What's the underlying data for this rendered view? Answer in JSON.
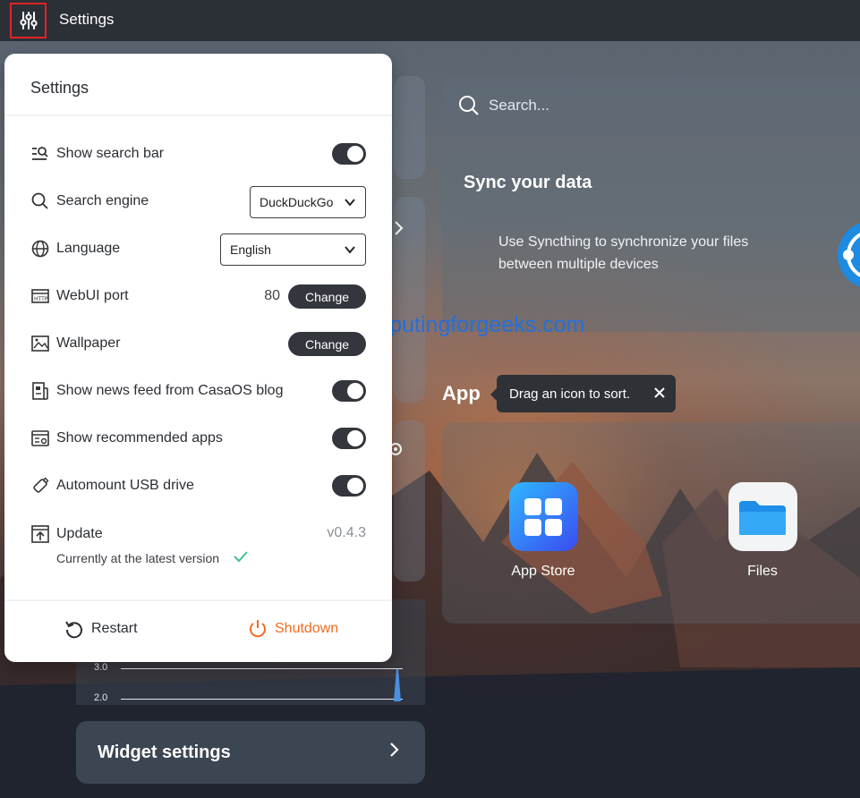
{
  "topbar": {
    "title": "Settings",
    "settings_icon": "sliders-icon"
  },
  "panel": {
    "title": "Settings",
    "rows": {
      "search_bar": {
        "label": "Show search bar",
        "enabled": true,
        "icon": "search-bar-icon"
      },
      "search_engine": {
        "label": "Search engine",
        "value": "DuckDuckGo",
        "icon": "search-icon"
      },
      "language": {
        "label": "Language",
        "value": "English",
        "icon": "globe-icon"
      },
      "webui_port": {
        "label": "WebUI port",
        "value": "80",
        "button": "Change",
        "icon": "http-icon"
      },
      "wallpaper": {
        "label": "Wallpaper",
        "button": "Change",
        "icon": "image-icon"
      },
      "news_feed": {
        "label": "Show news feed from CasaOS blog",
        "enabled": true,
        "icon": "news-icon"
      },
      "recommended_apps": {
        "label": "Show recommended apps",
        "enabled": true,
        "icon": "apps-window-icon"
      },
      "automount": {
        "label": "Automount USB drive",
        "enabled": true,
        "icon": "usb-icon"
      },
      "update": {
        "label": "Update",
        "version": "v0.4.3",
        "status": "Currently at the latest version",
        "icon": "update-icon"
      }
    },
    "footer": {
      "restart": "Restart",
      "shutdown": "Shutdown"
    }
  },
  "search": {
    "placeholder": "Search..."
  },
  "sync_card": {
    "title": "Sync your data",
    "description": "Use Syncthing to synchronize your files between multiple devices"
  },
  "watermark": "computingforgeeks.com",
  "apps": {
    "title": "App",
    "tooltip": "Drag an icon to sort.",
    "items": [
      {
        "name": "App Store",
        "icon": "app-store-icon"
      },
      {
        "name": "Files",
        "icon": "folder-icon"
      }
    ]
  },
  "chart_widget": {
    "ticks": [
      "3.0",
      "2.0"
    ]
  },
  "widget_settings": {
    "label": "Widget settings"
  },
  "colors": {
    "accent_orange": "#f26b21",
    "toggle_dark": "#33373d",
    "highlight_red": "#e02424"
  }
}
